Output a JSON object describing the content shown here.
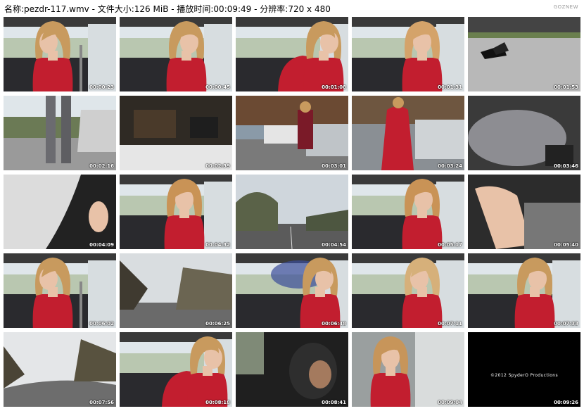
{
  "header": {
    "text": "名称:pezdr-117.wmv - 文件大小:126 MiB - 播放时间:00:09:49 - 分辨率:720 x 480",
    "brand": "GOZNEW"
  },
  "thumbnails": [
    {
      "time": "00:00:23",
      "scene": "driver-left"
    },
    {
      "time": "00:00:45",
      "scene": "driver-right"
    },
    {
      "time": "00:01:08",
      "scene": "driver-close"
    },
    {
      "time": "00:01:31",
      "scene": "driver-front"
    },
    {
      "time": "00:01:53",
      "scene": "heels-pavement"
    },
    {
      "time": "00:02:16",
      "scene": "legs-car"
    },
    {
      "time": "00:02:39",
      "scene": "under-car"
    },
    {
      "time": "00:03:01",
      "scene": "parking-phone"
    },
    {
      "time": "00:03:24",
      "scene": "red-coat-car"
    },
    {
      "time": "00:03:46",
      "scene": "pedal-gray"
    },
    {
      "time": "00:04:09",
      "scene": "footwell-light"
    },
    {
      "time": "00:04:32",
      "scene": "driver-smile"
    },
    {
      "time": "00:04:54",
      "scene": "road-trees"
    },
    {
      "time": "00:05:17",
      "scene": "driver-laugh"
    },
    {
      "time": "00:05:40",
      "scene": "foot-pedal"
    },
    {
      "time": "00:06:02",
      "scene": "driver-left"
    },
    {
      "time": "00:06:25",
      "scene": "road-woods"
    },
    {
      "time": "00:06:48",
      "scene": "driver-blur"
    },
    {
      "time": "00:07:11",
      "scene": "driver-turn"
    },
    {
      "time": "00:07:33",
      "scene": "driver-right"
    },
    {
      "time": "00:07:56",
      "scene": "road-curve"
    },
    {
      "time": "00:08:18",
      "scene": "driver-close"
    },
    {
      "time": "00:08:41",
      "scene": "dark-car"
    },
    {
      "time": "00:09:04",
      "scene": "driver-face"
    },
    {
      "time": "00:09:26",
      "scene": "black-credit",
      "text": "©2012 SpyderO Productions"
    }
  ],
  "colors": {
    "sky": "#dfe6ea",
    "skin": "#e8c2a8",
    "hair": "#c89a5e",
    "red": "#c21e2f",
    "seat": "#2a2a2e",
    "gray": "#8c8c8c",
    "road": "#6d6d6d",
    "tree": "#5a6248"
  }
}
